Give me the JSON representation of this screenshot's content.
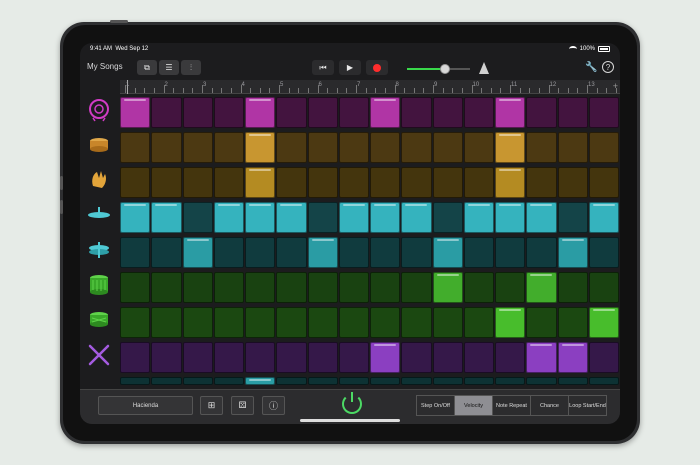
{
  "status": {
    "time": "9:41 AM",
    "date": "Wed Sep 12",
    "battery": "100%"
  },
  "toolbar": {
    "my_songs": "My Songs"
  },
  "ruler": {
    "bars": [
      "1",
      "2",
      "3",
      "4",
      "5",
      "6",
      "7",
      "8",
      "9",
      "10",
      "11",
      "12",
      "13"
    ]
  },
  "bottom": {
    "kit_name": "Hacienda",
    "modes": [
      "Step On/Off",
      "Velocity",
      "Note Repeat",
      "Chance",
      "Loop Start/End"
    ],
    "active_mode": "Velocity"
  },
  "icons": {
    "toolbar": [
      "browser-icon",
      "tracks-view-icon",
      "mixer-icon",
      "rewind-icon",
      "play-icon",
      "record-icon",
      "volume-slider",
      "metronome-icon",
      "settings-wrench-icon",
      "help-icon"
    ],
    "instruments": [
      "kick-drum-icon",
      "snare-drum-icon",
      "clap-icon",
      "cymbal-icon",
      "hi-hat-icon",
      "tom-icon",
      "floor-tom-icon",
      "drum-sticks-icon"
    ]
  },
  "colors": {
    "kick": "#b035a5",
    "snare": "#c89630",
    "clap": "#b48b22",
    "cymbal": "#35b3be",
    "hihat": "#2a9ca4",
    "tom": "#42ad2c",
    "floor_tom": "#48bd2c",
    "sticks": "#8b3fc1",
    "accent_green": "#4cd964",
    "record_red": "#ff2d2d"
  },
  "pattern": [
    {
      "name": "kick",
      "steps": [
        1,
        0,
        0,
        0,
        1,
        0,
        0,
        0,
        1,
        0,
        0,
        0,
        1,
        0,
        0,
        0
      ]
    },
    {
      "name": "snare",
      "steps": [
        0,
        0,
        0,
        0,
        1,
        0,
        0,
        0,
        0,
        0,
        0,
        0,
        1,
        0,
        0,
        0
      ]
    },
    {
      "name": "clap",
      "steps": [
        0,
        0,
        0,
        0,
        1,
        0,
        0,
        0,
        0,
        0,
        0,
        0,
        1,
        0,
        0,
        0
      ]
    },
    {
      "name": "cymbal",
      "steps": [
        1,
        1,
        0,
        1,
        1,
        1,
        0,
        1,
        1,
        1,
        0,
        1,
        1,
        1,
        0,
        1
      ]
    },
    {
      "name": "hihat",
      "steps": [
        0,
        0,
        1,
        0,
        0,
        0,
        1,
        0,
        0,
        0,
        1,
        0,
        0,
        0,
        1,
        0
      ]
    },
    {
      "name": "tom",
      "steps": [
        0,
        0,
        0,
        0,
        0,
        0,
        0,
        0,
        0,
        0,
        1,
        0,
        0,
        1,
        0,
        0
      ]
    },
    {
      "name": "floor_tom",
      "steps": [
        0,
        0,
        0,
        0,
        0,
        0,
        0,
        0,
        0,
        0,
        0,
        0,
        1,
        0,
        0,
        1
      ]
    },
    {
      "name": "sticks",
      "steps": [
        0,
        0,
        0,
        0,
        0,
        0,
        0,
        0,
        1,
        0,
        0,
        0,
        0,
        1,
        1,
        0
      ]
    },
    {
      "name": "partial",
      "steps": [
        0,
        0,
        0,
        0,
        1,
        0,
        0,
        0,
        0,
        0,
        0,
        0,
        0,
        0,
        0,
        0
      ]
    }
  ],
  "volume_level": 0.6
}
